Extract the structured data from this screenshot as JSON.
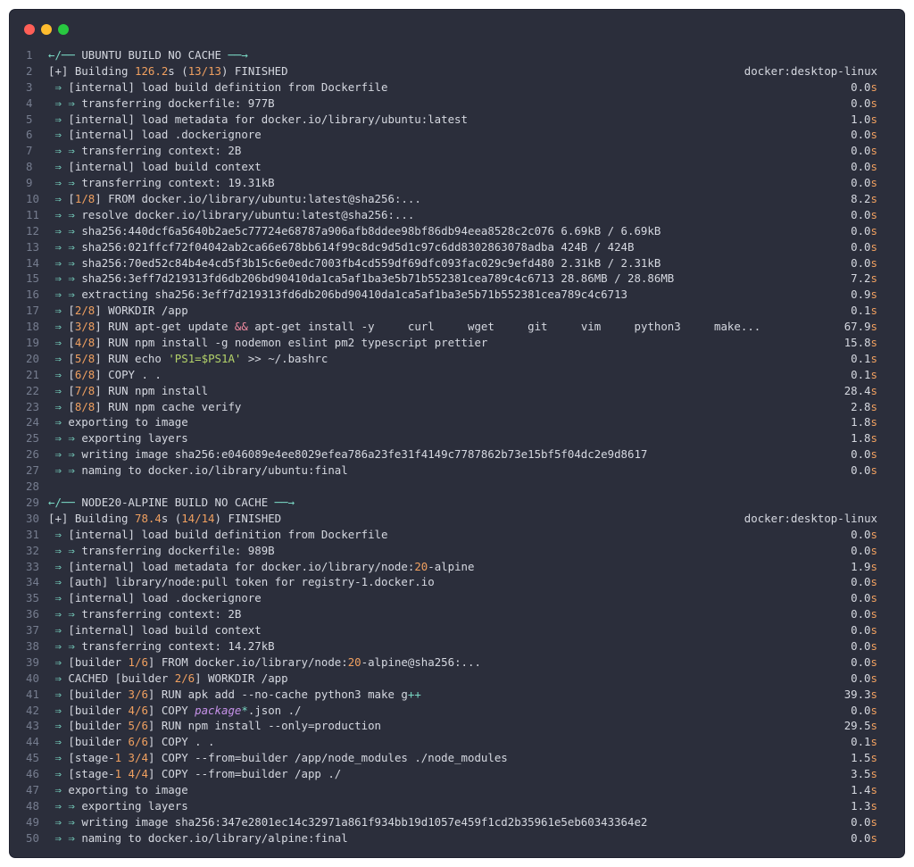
{
  "window": {
    "traffic_lights": [
      "close",
      "minimize",
      "zoom"
    ],
    "colors": {
      "background": "#2b2e3b",
      "text": "#d5d8e0",
      "arrow": "#7ad8c4",
      "number": "#f0a060",
      "keyword": "#f08aa0",
      "string": "#b4d36a",
      "line_number": "#767d8f"
    }
  },
  "lines": [
    {
      "n": "1",
      "segs": [
        [
          "arr",
          "←/── "
        ],
        [
          "",
          "UBUNTU BUILD NO CACHE "
        ],
        [
          "arr",
          "──→"
        ]
      ]
    },
    {
      "n": "2",
      "segs": [
        [
          "",
          "[+] Building "
        ],
        [
          "num",
          "126.2"
        ],
        [
          "",
          "s ("
        ],
        [
          "num",
          "13/13"
        ],
        [
          "",
          ") FINISHED"
        ]
      ],
      "right": "docker:desktop-linux",
      "wide": true
    },
    {
      "n": "3",
      "segs": [
        [
          "arr",
          " ⇒ "
        ],
        [
          "",
          "[internal] load build definition from Dockerfile"
        ]
      ],
      "right": "0.0s"
    },
    {
      "n": "4",
      "segs": [
        [
          "arr",
          " ⇒ ⇒ "
        ],
        [
          "",
          "transferring dockerfile: 977B"
        ]
      ],
      "right": "0.0s"
    },
    {
      "n": "5",
      "segs": [
        [
          "arr",
          " ⇒ "
        ],
        [
          "",
          "[internal] load metadata for docker.io/library/ubuntu:latest"
        ]
      ],
      "right": "1.0s"
    },
    {
      "n": "6",
      "segs": [
        [
          "arr",
          " ⇒ "
        ],
        [
          "",
          "[internal] load .dockerignore"
        ]
      ],
      "right": "0.0s"
    },
    {
      "n": "7",
      "segs": [
        [
          "arr",
          " ⇒ ⇒ "
        ],
        [
          "",
          "transferring context: 2B"
        ]
      ],
      "right": "0.0s"
    },
    {
      "n": "8",
      "segs": [
        [
          "arr",
          " ⇒ "
        ],
        [
          "",
          "[internal] load build context"
        ]
      ],
      "right": "0.0s"
    },
    {
      "n": "9",
      "segs": [
        [
          "arr",
          " ⇒ ⇒ "
        ],
        [
          "",
          "transferring context: 19.31kB"
        ]
      ],
      "right": "0.0s"
    },
    {
      "n": "10",
      "segs": [
        [
          "arr",
          " ⇒ "
        ],
        [
          "",
          "["
        ],
        [
          "num",
          "1/8"
        ],
        [
          "",
          "] FROM docker.io/library/ubuntu:latest@sha256:..."
        ]
      ],
      "right": "8.2s"
    },
    {
      "n": "11",
      "segs": [
        [
          "arr",
          " ⇒ ⇒ "
        ],
        [
          "",
          "resolve docker.io/library/ubuntu:latest@sha256:..."
        ]
      ],
      "right": "0.0s"
    },
    {
      "n": "12",
      "segs": [
        [
          "arr",
          " ⇒ ⇒ "
        ],
        [
          "",
          "sha256:440dcf6a5640b2ae5c77724e68787a906afb8ddee98bf86db94eea8528c2c076 6.69kB / 6.69kB"
        ]
      ],
      "right": "0.0s"
    },
    {
      "n": "13",
      "segs": [
        [
          "arr",
          " ⇒ ⇒ "
        ],
        [
          "",
          "sha256:021ffcf72f04042ab2ca66e678bb614f99c8dc9d5d1c97c6dd8302863078adba 424B / 424B"
        ]
      ],
      "right": "0.0s"
    },
    {
      "n": "14",
      "segs": [
        [
          "arr",
          " ⇒ ⇒ "
        ],
        [
          "",
          "sha256:70ed52c84b4e4cd5f3b15c6e0edc7003fb4cd559df69dfc093fac029c9efd480 2.31kB / 2.31kB"
        ]
      ],
      "right": "0.0s"
    },
    {
      "n": "15",
      "segs": [
        [
          "arr",
          " ⇒ ⇒ "
        ],
        [
          "",
          "sha256:3eff7d219313fd6db206bd90410da1ca5af1ba3e5b71b552381cea789c4c6713 28.86MB / 28.86MB"
        ]
      ],
      "right": "7.2s"
    },
    {
      "n": "16",
      "segs": [
        [
          "arr",
          " ⇒ ⇒ "
        ],
        [
          "",
          "extracting sha256:3eff7d219313fd6db206bd90410da1ca5af1ba3e5b71b552381cea789c4c6713"
        ]
      ],
      "right": "0.9s"
    },
    {
      "n": "17",
      "segs": [
        [
          "arr",
          " ⇒ "
        ],
        [
          "",
          "["
        ],
        [
          "num",
          "2/8"
        ],
        [
          "",
          "] WORKDIR /app"
        ]
      ],
      "right": "0.1s"
    },
    {
      "n": "18",
      "segs": [
        [
          "arr",
          " ⇒ "
        ],
        [
          "",
          "["
        ],
        [
          "num",
          "3/8"
        ],
        [
          "",
          "] RUN apt-get update "
        ],
        [
          "kw",
          "&&"
        ],
        [
          "",
          " apt-get install -y     curl     wget     git     vim     python3     make..."
        ]
      ],
      "right": "67.9s"
    },
    {
      "n": "19",
      "segs": [
        [
          "arr",
          " ⇒ "
        ],
        [
          "",
          "["
        ],
        [
          "num",
          "4/8"
        ],
        [
          "",
          "] RUN npm install -g nodemon eslint pm2 typescript prettier"
        ]
      ],
      "right": "15.8s"
    },
    {
      "n": "20",
      "segs": [
        [
          "arr",
          " ⇒ "
        ],
        [
          "",
          "["
        ],
        [
          "num",
          "5/8"
        ],
        [
          "",
          "] RUN echo "
        ],
        [
          "str",
          "'PS1=$PS1A'"
        ],
        [
          "",
          " >> ~/.bashrc"
        ]
      ],
      "right": "0.1s"
    },
    {
      "n": "21",
      "segs": [
        [
          "arr",
          " ⇒ "
        ],
        [
          "",
          "["
        ],
        [
          "num",
          "6/8"
        ],
        [
          "",
          "] COPY . ."
        ]
      ],
      "right": "0.1s"
    },
    {
      "n": "22",
      "segs": [
        [
          "arr",
          " ⇒ "
        ],
        [
          "",
          "["
        ],
        [
          "num",
          "7/8"
        ],
        [
          "",
          "] RUN npm install"
        ]
      ],
      "right": "28.4s"
    },
    {
      "n": "23",
      "segs": [
        [
          "arr",
          " ⇒ "
        ],
        [
          "",
          "["
        ],
        [
          "num",
          "8/8"
        ],
        [
          "",
          "] RUN npm cache verify"
        ]
      ],
      "right": "2.8s"
    },
    {
      "n": "24",
      "segs": [
        [
          "arr",
          " ⇒ "
        ],
        [
          "",
          "exporting to image"
        ]
      ],
      "right": "1.8s"
    },
    {
      "n": "25",
      "segs": [
        [
          "arr",
          " ⇒ ⇒ "
        ],
        [
          "",
          "exporting layers"
        ]
      ],
      "right": "1.8s"
    },
    {
      "n": "26",
      "segs": [
        [
          "arr",
          " ⇒ ⇒ "
        ],
        [
          "",
          "writing image sha256:e046089e4ee8029efea786a23fe31f4149c7787862b73e15bf5f04dc2e9d8617"
        ]
      ],
      "right": "0.0s"
    },
    {
      "n": "27",
      "segs": [
        [
          "arr",
          " ⇒ ⇒ "
        ],
        [
          "",
          "naming to docker.io/library/ubuntu:final"
        ]
      ],
      "right": "0.0s"
    },
    {
      "n": "28",
      "segs": []
    },
    {
      "n": "29",
      "segs": [
        [
          "arr",
          "←/── "
        ],
        [
          "",
          "NODE20-ALPINE BUILD NO CACHE "
        ],
        [
          "arr",
          "──→"
        ]
      ]
    },
    {
      "n": "30",
      "segs": [
        [
          "",
          "[+] Building "
        ],
        [
          "num",
          "78.4"
        ],
        [
          "",
          "s ("
        ],
        [
          "num",
          "14/14"
        ],
        [
          "",
          ") FINISHED"
        ]
      ],
      "right": "docker:desktop-linux",
      "wide": true
    },
    {
      "n": "31",
      "segs": [
        [
          "arr",
          " ⇒ "
        ],
        [
          "",
          "[internal] load build definition from Dockerfile"
        ]
      ],
      "right": "0.0s"
    },
    {
      "n": "32",
      "segs": [
        [
          "arr",
          " ⇒ ⇒ "
        ],
        [
          "",
          "transferring dockerfile: 989B"
        ]
      ],
      "right": "0.0s"
    },
    {
      "n": "33",
      "segs": [
        [
          "arr",
          " ⇒ "
        ],
        [
          "",
          "[internal] load metadata for docker.io/library/node:"
        ],
        [
          "num",
          "20"
        ],
        [
          "",
          "-alpine"
        ]
      ],
      "right": "1.9s"
    },
    {
      "n": "34",
      "segs": [
        [
          "arr",
          " ⇒ "
        ],
        [
          "",
          "[auth] library/node:pull token for registry-1.docker.io"
        ]
      ],
      "right": "0.0s"
    },
    {
      "n": "35",
      "segs": [
        [
          "arr",
          " ⇒ "
        ],
        [
          "",
          "[internal] load .dockerignore"
        ]
      ],
      "right": "0.0s"
    },
    {
      "n": "36",
      "segs": [
        [
          "arr",
          " ⇒ ⇒ "
        ],
        [
          "",
          "transferring context: 2B"
        ]
      ],
      "right": "0.0s"
    },
    {
      "n": "37",
      "segs": [
        [
          "arr",
          " ⇒ "
        ],
        [
          "",
          "[internal] load build context"
        ]
      ],
      "right": "0.0s"
    },
    {
      "n": "38",
      "segs": [
        [
          "arr",
          " ⇒ ⇒ "
        ],
        [
          "",
          "transferring context: 14.27kB"
        ]
      ],
      "right": "0.0s"
    },
    {
      "n": "39",
      "segs": [
        [
          "arr",
          " ⇒ "
        ],
        [
          "",
          "[builder "
        ],
        [
          "num",
          "1/6"
        ],
        [
          "",
          "] FROM docker.io/library/node:"
        ],
        [
          "num",
          "20"
        ],
        [
          "",
          "-alpine@sha256:..."
        ]
      ],
      "right": "0.0s"
    },
    {
      "n": "40",
      "segs": [
        [
          "arr",
          " ⇒ "
        ],
        [
          "",
          "CACHED [builder "
        ],
        [
          "num",
          "2/6"
        ],
        [
          "",
          "] WORKDIR /app"
        ]
      ],
      "right": "0.0s"
    },
    {
      "n": "41",
      "segs": [
        [
          "arr",
          " ⇒ "
        ],
        [
          "",
          "[builder "
        ],
        [
          "num",
          "3/6"
        ],
        [
          "",
          "] RUN apk add --no-cache python3 make g"
        ],
        [
          "op",
          "++"
        ]
      ],
      "right": "39.3s"
    },
    {
      "n": "42",
      "segs": [
        [
          "arr",
          " ⇒ "
        ],
        [
          "",
          "[builder "
        ],
        [
          "num",
          "4/6"
        ],
        [
          "",
          "] COPY "
        ],
        [
          "pkg",
          "package"
        ],
        [
          "op",
          "*"
        ],
        [
          "",
          ".json ./"
        ]
      ],
      "right": "0.0s"
    },
    {
      "n": "43",
      "segs": [
        [
          "arr",
          " ⇒ "
        ],
        [
          "",
          "[builder "
        ],
        [
          "num",
          "5/6"
        ],
        [
          "",
          "] RUN npm install --only=production"
        ]
      ],
      "right": "29.5s"
    },
    {
      "n": "44",
      "segs": [
        [
          "arr",
          " ⇒ "
        ],
        [
          "",
          "[builder "
        ],
        [
          "num",
          "6/6"
        ],
        [
          "",
          "] COPY . ."
        ]
      ],
      "right": "0.1s"
    },
    {
      "n": "45",
      "segs": [
        [
          "arr",
          " ⇒ "
        ],
        [
          "",
          "[stage-"
        ],
        [
          "num",
          "1"
        ],
        [
          "",
          " "
        ],
        [
          "num",
          "3/4"
        ],
        [
          "",
          "] COPY --from=builder /app/node_modules ./node_modules"
        ]
      ],
      "right": "1.5s"
    },
    {
      "n": "46",
      "segs": [
        [
          "arr",
          " ⇒ "
        ],
        [
          "",
          "[stage-"
        ],
        [
          "num",
          "1"
        ],
        [
          "",
          " "
        ],
        [
          "num",
          "4/4"
        ],
        [
          "",
          "] COPY --from=builder /app ./"
        ]
      ],
      "right": "3.5s"
    },
    {
      "n": "47",
      "segs": [
        [
          "arr",
          " ⇒ "
        ],
        [
          "",
          "exporting to image"
        ]
      ],
      "right": "1.4s"
    },
    {
      "n": "48",
      "segs": [
        [
          "arr",
          " ⇒ ⇒ "
        ],
        [
          "",
          "exporting layers"
        ]
      ],
      "right": "1.3s"
    },
    {
      "n": "49",
      "segs": [
        [
          "arr",
          " ⇒ ⇒ "
        ],
        [
          "",
          "writing image sha256:347e2801ec14c32971a861f934bb19d1057e459f1cd2b35961e5eb60343364e2"
        ]
      ],
      "right": "0.0s"
    },
    {
      "n": "50",
      "segs": [
        [
          "arr",
          " ⇒ ⇒ "
        ],
        [
          "",
          "naming to docker.io/library/alpine:final"
        ]
      ],
      "right": "0.0s"
    }
  ]
}
